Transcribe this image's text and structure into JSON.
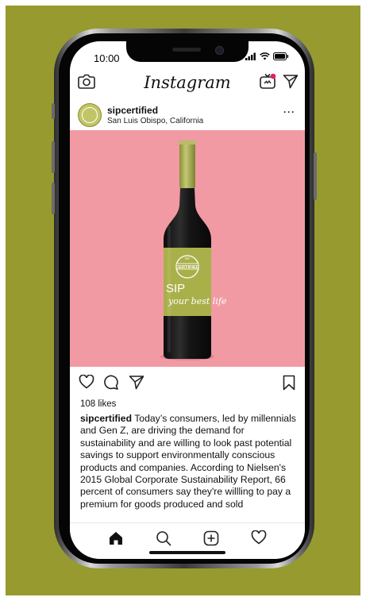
{
  "status_bar": {
    "time": "10:00"
  },
  "header": {
    "logo": "Instagram",
    "camera_icon": "camera-icon",
    "igtv_icon": "igtv-icon",
    "direct_icon": "paper-plane-icon"
  },
  "post": {
    "username": "sipcertified",
    "location": "San Luis Obispo, California",
    "more": "···",
    "image": {
      "background": "#f19aa3",
      "label_color": "#a9b04a",
      "badge_lines": [
        "SIP",
        "CERTIFIED"
      ],
      "label_sip": "SIP",
      "label_tagline": "your best life"
    },
    "likes": "108 likes",
    "caption_user": "sipcertified",
    "caption_text": " Today’s consumers, led by millennials and Gen Z, are driving the demand for sustainability and are willing to look past potential savings to support environmentally conscious products and companies. According to Nielsen's 2015 Global Corporate Sustainability Report, 66 percent of consumers say they're willling to pay a premium for goods produced and sold"
  },
  "tabbar": {
    "items": [
      "home-icon",
      "search-icon",
      "add-post-icon",
      "heart-icon"
    ]
  },
  "colors": {
    "page_bg": "#979a2f",
    "image_bg": "#f19aa3",
    "notification_dot": "#e0245e"
  }
}
